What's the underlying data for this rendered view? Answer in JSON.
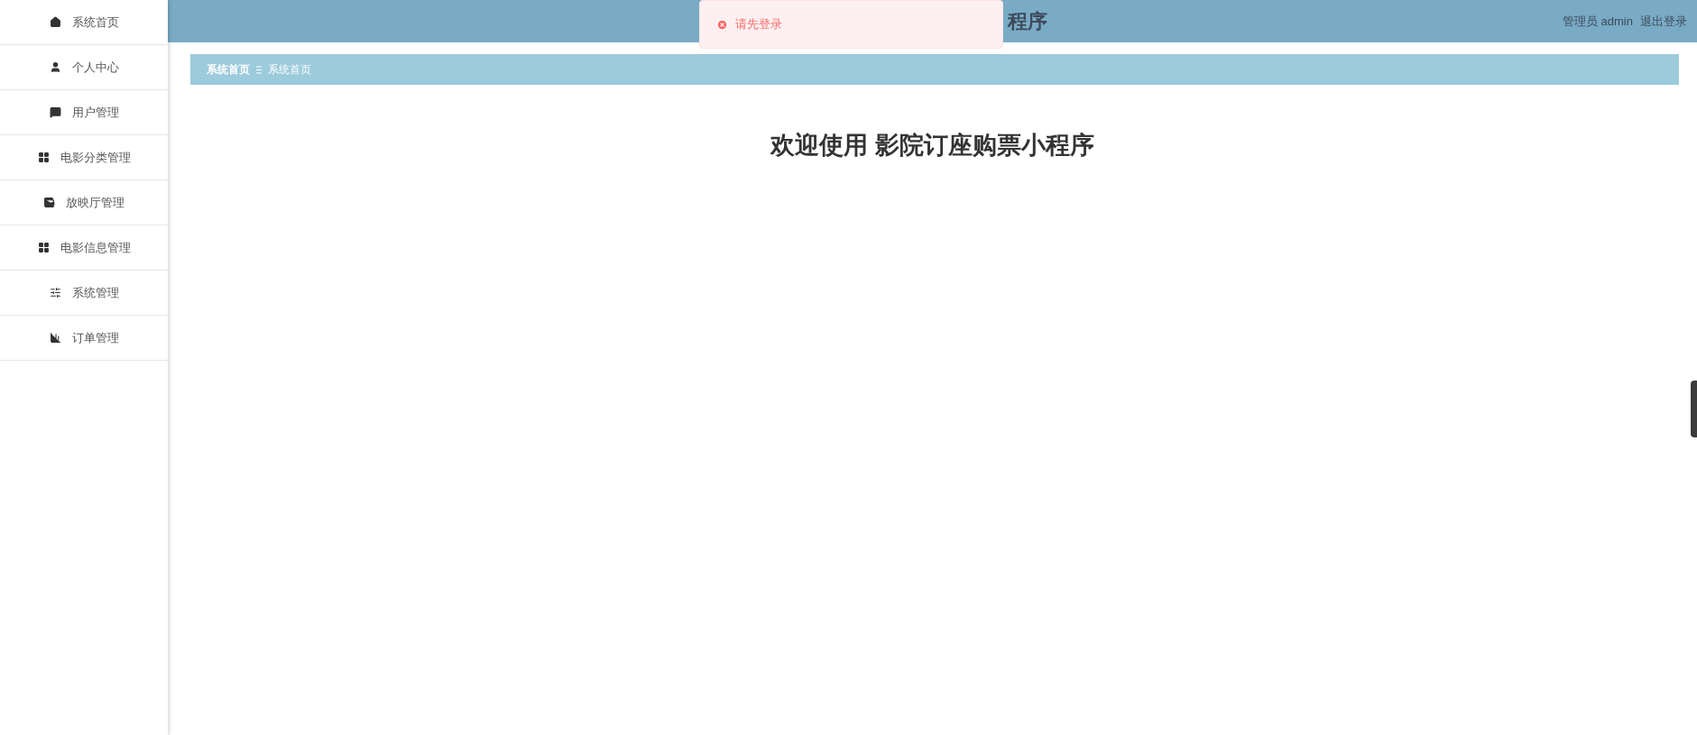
{
  "sidebar": {
    "items": [
      {
        "label": "系统首页"
      },
      {
        "label": "个人中心"
      },
      {
        "label": "用户管理"
      },
      {
        "label": "电影分类管理"
      },
      {
        "label": "放映厅管理"
      },
      {
        "label": "电影信息管理"
      },
      {
        "label": "系统管理"
      },
      {
        "label": "订单管理"
      }
    ]
  },
  "header": {
    "title": "程序",
    "user": "管理员 admin",
    "logout": "退出登录"
  },
  "toast": {
    "message": "请先登录"
  },
  "breadcrumb": [
    "系统首页",
    "系统首页"
  ],
  "welcome": "欢迎使用 影院订座购票小程序"
}
